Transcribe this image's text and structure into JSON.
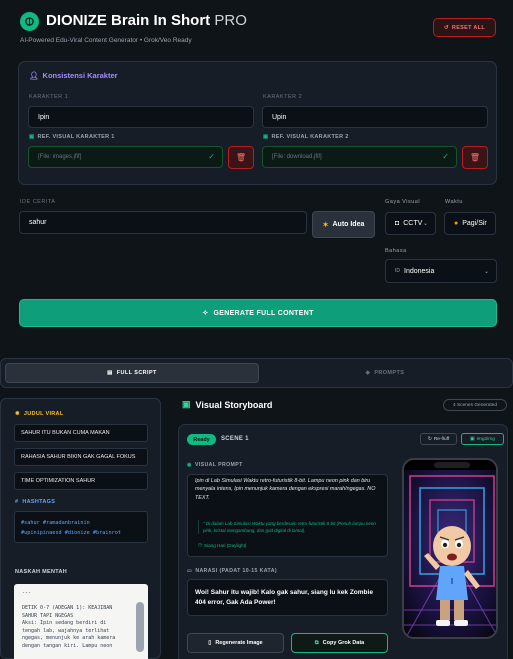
{
  "header": {
    "title": "DIONIZE Brain In Short",
    "title_suffix": "PRO",
    "subtitle": "AI-Powered Edu-Viral Content Generator • Grok/Veo Ready",
    "reset_label": "RESET ALL"
  },
  "characters": {
    "section_title": "Konsistensi Karakter",
    "char1_label": "KARAKTER 1",
    "char1_value": "Ipin",
    "char2_label": "KARAKTER 2",
    "char2_value": "Upin",
    "ref1_label": "REF. VISUAL KARAKTER 1",
    "ref1_value": "[File: images.jfif]",
    "ref2_label": "REF. VISUAL KARAKTER 2",
    "ref2_value": "[File: download.jfif]"
  },
  "story": {
    "idea_label": "IDE CERITA",
    "idea_value": "sahur",
    "auto_idea_label": "Auto Idea",
    "gaya_label": "Gaya Visual",
    "gaya_value": "CCTV",
    "waktu_label": "Waktu",
    "waktu_value": "Pagi/Sir",
    "bahasa_label": "Bahasa",
    "bahasa_value": "Indonesia",
    "bahasa_flag": "ID",
    "generate_label": "GENERATE FULL CONTENT"
  },
  "tabs": {
    "full_script": "FULL SCRIPT",
    "prompts": "PROMPTS"
  },
  "left": {
    "judul_title": "JUDUL VIRAL",
    "titles": [
      "SAHUR ITU BUKAN CUMA MAKAN",
      "RAHASIA SAHUR BIKIN GAK GAGAL FOKUS",
      "TIME OPTIMIZATION SAHUR"
    ],
    "hashtags_title": "HASHTAGS",
    "hashtags_line1": "#sahur #ramadanbrainin",
    "hashtags_line2": "#upinipinaesd #dionize #brainrot",
    "naskah_title": "NASKAH MENTAH",
    "script_text": "---\n\nDETIK 0-7 (ADEGAN 1): KEAJIBAN\nSAHUR TAPI NGEGAS\nAksi: Ipin sedang berdiri di\ntengah lab, wajahnya terlihat\nngegas, menunjuk ke arah kamera\ndengan tangan kiri. Lampu neon"
  },
  "storyboard": {
    "title": "Visual Storyboard",
    "scene_count": "4 Scenes Generated",
    "ready_label": "Ready",
    "scene_label": "SCENE 1",
    "refill_label": "Re-fluff",
    "img2img_label": "Img2img",
    "vp_label": "VISUAL PROMPT",
    "vp_text": "Ipin di Lab Simulasi Waktu retro-futuristik 8-bit. Lampu neon pink dan biru menyala intens, Ipin menunjuk kamera dengan ekspresi marah/ngegas. NO TEXT.",
    "vp_sub": "\" Di dalam Lab Simulasi Waktu yang berdesain retro-futuristik 8-bit (Penuh lampu neon pink, kristal mengambang, dan grid digital di lantai).",
    "vp_meta": "Siang Hari (Daylight)",
    "narasi_label": "NARASI (PADAT 10-15 KATA)",
    "narasi_text": "Woi! Sahur itu wajib! Kalo gak sahur, siang lu kek Zombie 404 error, Gak Ada Power!",
    "regen_label": "Regenerate Image",
    "copy_label": "Copy Grok Data"
  }
}
